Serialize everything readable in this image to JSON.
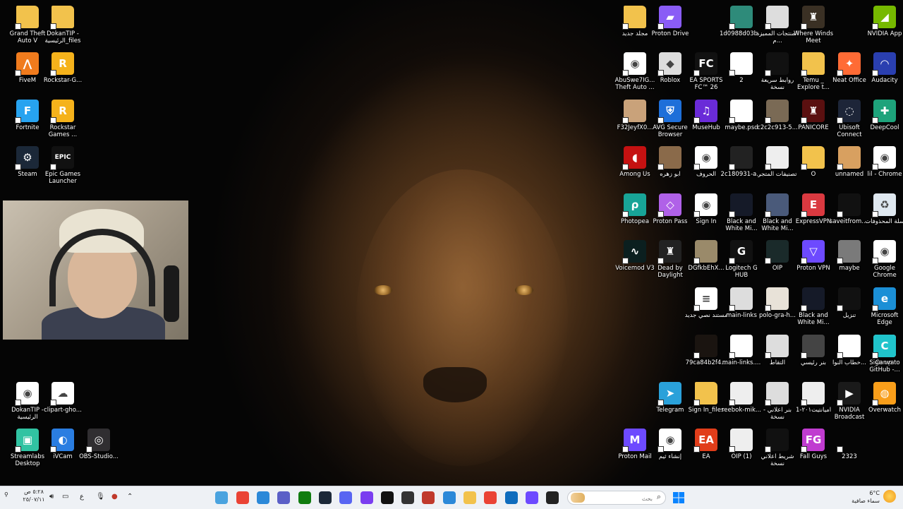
{
  "desktop_icons_left": [
    {
      "label": "Grand Theft Auto V",
      "icon": "folder-icon",
      "color": "#f2c24c"
    },
    {
      "label": "DokanTIP - الرئيسية_files",
      "icon": "folder-icon",
      "color": "#f2c24c"
    },
    {
      "label": "FiveM",
      "icon": "fivem-icon",
      "color": "#f07b1d"
    },
    {
      "label": "Rockstar-G...",
      "icon": "rockstar-icon",
      "color": "#f5b21b"
    },
    {
      "label": "Fortnite",
      "icon": "fortnite-icon",
      "color": "#27a3f0"
    },
    {
      "label": "Rockstar Games ...",
      "icon": "rockstar-icon",
      "color": "#f5b21b"
    },
    {
      "label": "Steam",
      "icon": "steam-icon",
      "color": "#1b2838"
    },
    {
      "label": "Epic Games Launcher",
      "icon": "epic-icon",
      "color": "#111111"
    },
    {
      "label": "DokanTIP - الرئيسية",
      "icon": "chrome-icon",
      "color": "#ffffff"
    },
    {
      "label": "clipart-gho...",
      "icon": "ghost-icon",
      "color": "#ffffff"
    },
    {
      "label": "Streamlabs Desktop",
      "icon": "streamlabs-icon",
      "color": "#31c3a2"
    },
    {
      "label": "iVCam",
      "icon": "ivcam-icon",
      "color": "#2a7de1"
    },
    {
      "label": "OBS-Studio...",
      "icon": "obs-icon",
      "color": "#302e31"
    }
  ],
  "desktop_icons_right": [
    {
      "label": "مجلد جديد",
      "icon": "folder-icon",
      "color": "#f2c24c"
    },
    {
      "label": "Proton Drive",
      "icon": "proton-drive-icon",
      "color": "#8a5cf6"
    },
    {
      "label": "1d0988d03b...",
      "icon": "image-icon",
      "color": "#2e8b7a"
    },
    {
      "label": "المنتجات المميزة م...",
      "icon": "image-icon",
      "color": "#dddddd"
    },
    {
      "label": "Where Winds Meet",
      "icon": "game-icon",
      "color": "#3a3024"
    },
    {
      "label": "NVIDIA App",
      "icon": "nvidia-icon",
      "color": "#76b900"
    },
    {
      "label": "AbuSwe7IG... Theft Auto ...",
      "icon": "chrome-icon",
      "color": "#ffffff"
    },
    {
      "label": "Roblox",
      "icon": "roblox-icon",
      "color": "#dddddd"
    },
    {
      "label": "EA SPORTS FC™ 26",
      "icon": "ea-fc-icon",
      "color": "#111111"
    },
    {
      "label": "2",
      "icon": "file-icon",
      "color": "#ffffff"
    },
    {
      "label": "روابط سريعة نسخة",
      "icon": "image-icon",
      "color": "#111111"
    },
    {
      "label": "Temu _ Explore t...",
      "icon": "folder-icon",
      "color": "#f2c24c"
    },
    {
      "label": "Neat Office",
      "icon": "neat-office-icon",
      "color": "#ff6b35"
    },
    {
      "label": "Audacity",
      "icon": "audacity-icon",
      "color": "#2a3fb0"
    },
    {
      "label": "F32JeyfX0...",
      "icon": "image-icon",
      "color": "#c9a27a"
    },
    {
      "label": "AVG Secure Browser",
      "icon": "avg-icon",
      "color": "#1e6fd9"
    },
    {
      "label": "MuseHub",
      "icon": "musehub-icon",
      "color": "#6a2bd8"
    },
    {
      "label": "maybe.psd",
      "icon": "file-icon",
      "color": "#ffffff"
    },
    {
      "label": "c2c2c913-5...",
      "icon": "image-icon",
      "color": "#7a6a55"
    },
    {
      "label": "PANICORE",
      "icon": "game-icon",
      "color": "#5a1010"
    },
    {
      "label": "Ubisoft Connect",
      "icon": "ubisoft-icon",
      "color": "#1d2538"
    },
    {
      "label": "DeepCool",
      "icon": "deepcool-icon",
      "color": "#1ea37b"
    },
    {
      "label": "Among Us",
      "icon": "among-us-icon",
      "color": "#c51111"
    },
    {
      "label": "ابو زهره",
      "icon": "image-icon",
      "color": "#8a6a4a"
    },
    {
      "label": "الحروف",
      "icon": "chrome-icon",
      "color": "#ffffff"
    },
    {
      "label": "2c180931-a...",
      "icon": "image-icon",
      "color": "#222222"
    },
    {
      "label": "تصنيفات المتجر",
      "icon": "image-icon",
      "color": "#eeeeee"
    },
    {
      "label": "O",
      "icon": "folder-icon",
      "color": "#f2c24c"
    },
    {
      "label": "unnamed",
      "icon": "image-icon",
      "color": "#d8a060"
    },
    {
      "label": "lil - Chrome",
      "icon": "chrome-icon",
      "color": "#ffffff"
    },
    {
      "label": "Photopea",
      "icon": "photopea-icon",
      "color": "#18a497"
    },
    {
      "label": "Proton Pass",
      "icon": "proton-pass-icon",
      "color": "#b061e8"
    },
    {
      "label": "Sign In",
      "icon": "chrome-icon",
      "color": "#ffffff"
    },
    {
      "label": "Black and White Mi...",
      "icon": "image-icon",
      "color": "#151a28"
    },
    {
      "label": "Black and White Mi...",
      "icon": "image-icon",
      "color": "#4a5a7a"
    },
    {
      "label": "ExpressVPN",
      "icon": "expressvpn-icon",
      "color": "#da3940"
    },
    {
      "label": "saveitfrom....",
      "icon": "image-icon",
      "color": "#111111"
    },
    {
      "label": "سلة المحذوفات",
      "icon": "recycle-bin-icon",
      "color": "#dfe8f0"
    },
    {
      "label": "Voicemod V3",
      "icon": "voicemod-icon",
      "color": "#0b1f1f"
    },
    {
      "label": "Dead by Daylight",
      "icon": "game-icon",
      "color": "#222222"
    },
    {
      "label": "DGfkbEhX...",
      "icon": "image-icon",
      "color": "#9a8a6a"
    },
    {
      "label": "Logitech G HUB",
      "icon": "logitech-icon",
      "color": "#111111"
    },
    {
      "label": "OIP",
      "icon": "image-icon",
      "color": "#1a2a2a"
    },
    {
      "label": "Proton VPN",
      "icon": "proton-vpn-icon",
      "color": "#6d4aff"
    },
    {
      "label": "maybe",
      "icon": "image-icon",
      "color": "#7a7a7a"
    },
    {
      "label": "Google Chrome",
      "icon": "chrome-icon",
      "color": "#ffffff"
    },
    {
      "label": "مستند نصي جديد",
      "icon": "text-file-icon",
      "color": "#ffffff"
    },
    {
      "label": "main-links",
      "icon": "image-icon",
      "color": "#dddddd"
    },
    {
      "label": "polo-gra-h...",
      "icon": "image-icon",
      "color": "#e8e2d8"
    },
    {
      "label": "Black and White Mi...",
      "icon": "image-icon",
      "color": "#151a28"
    },
    {
      "label": "تنزيل",
      "icon": "image-icon",
      "color": "#111111"
    },
    {
      "label": "Microsoft Edge",
      "icon": "edge-icon",
      "color": "#1b8fd6"
    },
    {
      "label": "79ca84b2f4...",
      "icon": "image-icon",
      "color": "#1a1410"
    },
    {
      "label": "main-links....",
      "icon": "file-icon",
      "color": "#ffffff"
    },
    {
      "label": "التقاط",
      "icon": "image-icon",
      "color": "#dddddd"
    },
    {
      "label": "بنر رئيسي",
      "icon": "image-icon",
      "color": "#444444"
    },
    {
      "label": "خطاب النوا...",
      "icon": "file-icon",
      "color": "#ffffff"
    },
    {
      "label": "Sign up to GitHub -...",
      "icon": "chrome-icon",
      "color": "#ffffff"
    },
    {
      "label": "Canva",
      "icon": "canva-icon",
      "color": "#20c4cb"
    },
    {
      "label": "Telegram",
      "icon": "telegram-icon",
      "color": "#2aa1da"
    },
    {
      "label": "Sign In_files",
      "icon": "folder-icon",
      "color": "#f2c24c"
    },
    {
      "label": "reebok-mik...",
      "icon": "image-icon",
      "color": "#eeeeee"
    },
    {
      "label": "بنر اعلاني - نسخة",
      "icon": "image-icon",
      "color": "#dddddd"
    },
    {
      "label": "اميانتيت٢٠١-1",
      "icon": "image-icon",
      "color": "#eeeeee"
    },
    {
      "label": "NVIDIA Broadcast",
      "icon": "nvidia-broadcast-icon",
      "color": "#1a1a1a"
    },
    {
      "label": "Overwatch",
      "icon": "overwatch-icon",
      "color": "#f99e1a"
    },
    {
      "label": "Proton Mail",
      "icon": "proton-mail-icon",
      "color": "#6d4aff"
    },
    {
      "label": "إنشاء ثيم",
      "icon": "chrome-icon",
      "color": "#ffffff"
    },
    {
      "label": "EA",
      "icon": "ea-icon",
      "color": "#e13d1a"
    },
    {
      "label": "OIP (1)",
      "icon": "image-icon",
      "color": "#eeeeee"
    },
    {
      "label": "شريط اعلاني نسخة",
      "icon": "image-icon",
      "color": "#111111"
    },
    {
      "label": "Fall Guys",
      "icon": "fall-guys-icon",
      "color": "#c03cd0"
    },
    {
      "label": "2323",
      "icon": "image-icon",
      "color": "#050505"
    }
  ],
  "taskbar": {
    "search_placeholder": "بحث",
    "icons": [
      {
        "name": "widgets-icon",
        "color": "#4aa3df"
      },
      {
        "name": "chrome-icon",
        "color": "#ea4335"
      },
      {
        "name": "notepad-icon",
        "color": "#2b88d8"
      },
      {
        "name": "teams-icon",
        "color": "#5b5fc7"
      },
      {
        "name": "xbox-icon",
        "color": "#107c10"
      },
      {
        "name": "steam-icon",
        "color": "#1b2838"
      },
      {
        "name": "discord-icon",
        "color": "#5865f2"
      },
      {
        "name": "headset-icon",
        "color": "#7a3df0"
      },
      {
        "name": "epic-icon",
        "color": "#111111"
      },
      {
        "name": "unity-icon",
        "color": "#333333"
      },
      {
        "name": "game-icon",
        "color": "#c0392b"
      },
      {
        "name": "store-icon",
        "color": "#2b88d8"
      },
      {
        "name": "file-explorer-icon",
        "color": "#f2c24c"
      },
      {
        "name": "chrome-icon",
        "color": "#ea4335"
      },
      {
        "name": "outlook-icon",
        "color": "#0f6cbd"
      },
      {
        "name": "proton-icon",
        "color": "#6d4aff"
      },
      {
        "name": "terminal-icon",
        "color": "#222222"
      }
    ],
    "start_icon": "windows-icon",
    "weather_temp": "6°C",
    "weather_desc": "سماء صافية",
    "time": "٥:٢٨ ص",
    "date": "٢٥/٠٧/١١",
    "lang": "ع"
  },
  "colors": {
    "taskbar_bg": "#eef1f5",
    "text_light": "#ffffff"
  }
}
